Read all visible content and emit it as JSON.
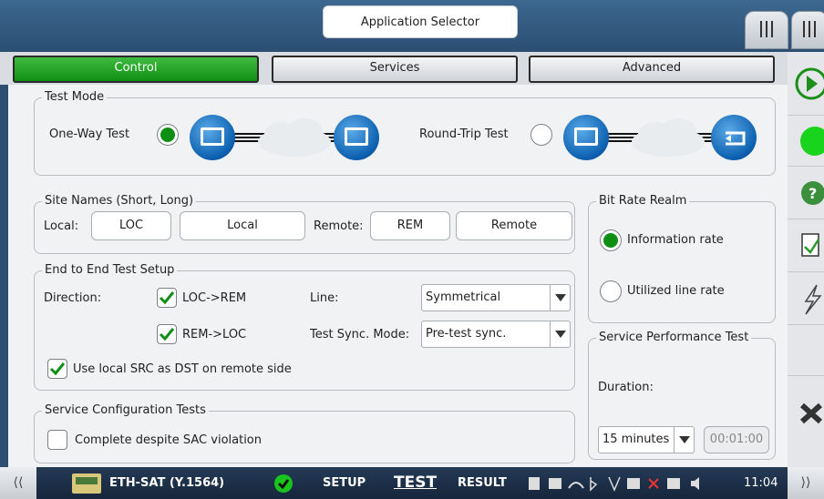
{
  "header": {
    "app_selector": "Application Selector"
  },
  "tabs": [
    {
      "label": "Control",
      "active": true
    },
    {
      "label": "Services",
      "active": false
    },
    {
      "label": "Advanced",
      "active": false
    }
  ],
  "test_mode": {
    "legend": "Test Mode",
    "one_way_label": "One-Way Test",
    "one_way_selected": true,
    "round_trip_label": "Round-Trip Test",
    "round_trip_selected": false
  },
  "site_names": {
    "legend": "Site Names (Short, Long)",
    "local_label": "Local:",
    "local_short": "LOC",
    "local_long": "Local",
    "remote_label": "Remote:",
    "remote_short": "REM",
    "remote_long": "Remote"
  },
  "bit_rate": {
    "legend": "Bit Rate Realm",
    "info_rate": "Information rate",
    "info_selected": true,
    "utilized_rate": "Utilized line rate",
    "utilized_selected": false
  },
  "e2e": {
    "legend": "End to End Test Setup",
    "direction_label": "Direction:",
    "loc_rem": "LOC->REM",
    "rem_loc": "REM->LOC",
    "line_label": "Line:",
    "line_value": "Symmetrical",
    "sync_label": "Test Sync. Mode:",
    "sync_value": "Pre-test sync.",
    "use_src": "Use local SRC as DST on remote side"
  },
  "service_perf": {
    "legend": "Service Performance Test",
    "duration_label": "Duration:",
    "duration_value": "15 minutes",
    "duration_time": "00:01:00"
  },
  "service_config": {
    "legend": "Service Configuration Tests",
    "complete_label": "Complete despite SAC violation",
    "complete_checked": false
  },
  "bottom": {
    "app_name": "ETH-SAT (Y.1564)",
    "setup": "SETUP",
    "test": "TEST",
    "result": "RESULT",
    "time": "11:04"
  },
  "colors": {
    "accent_green": "#0e8f14",
    "header_blue": "#2b4e72",
    "play": "#1a8f1a"
  },
  "icons": [
    "menu-bars-icon",
    "play-icon",
    "status-led-icon",
    "help-icon",
    "report-icon",
    "lightning-icon",
    "close-icon",
    "check-circle-icon"
  ]
}
